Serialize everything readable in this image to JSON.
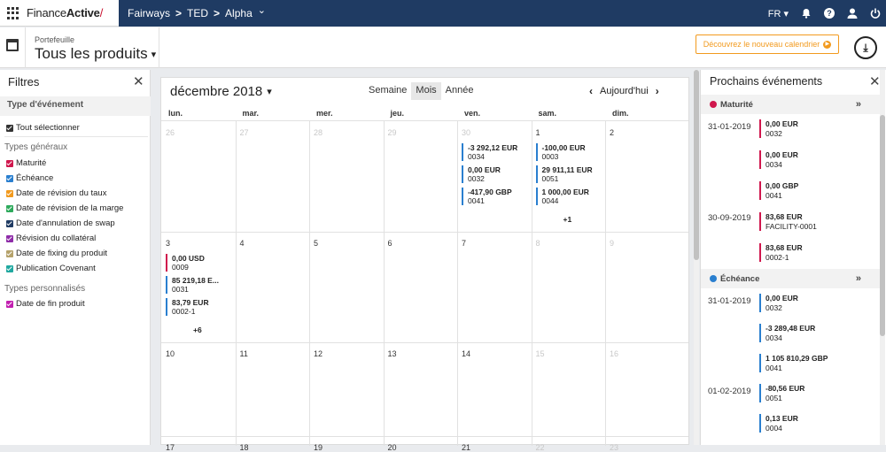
{
  "app": {
    "logo_main": "Finance",
    "logo_bold": "Active",
    "logo_slash": "/"
  },
  "breadcrumb": {
    "items": [
      "Fairways",
      "TED",
      "Alpha"
    ],
    "sep": ">",
    "caret": "⌄"
  },
  "topright": {
    "lang": "FR ▾"
  },
  "header": {
    "portfolio_label": "Portefeuille",
    "portfolio_title": "Tous les produits",
    "caret": "▾",
    "new_calendar": "Découvrez le nouveau calendrier",
    "play": "▶",
    "download": "⤓"
  },
  "filters": {
    "title": "Filtres",
    "close": "✕",
    "section": "Type d'événement",
    "select_all": "Tout sélectionner",
    "general_label": "Types généraux",
    "general": [
      {
        "label": "Maturité",
        "color": "#d0174d"
      },
      {
        "label": "Échéance",
        "color": "#2a7fcf"
      },
      {
        "label": "Date de révision du taux",
        "color": "#f29a1e"
      },
      {
        "label": "Date de révision de la marge",
        "color": "#2eaa5c"
      },
      {
        "label": "Date d'annulation de swap",
        "color": "#1f3b63"
      },
      {
        "label": "Révision du collatéral",
        "color": "#8e2ca8"
      },
      {
        "label": "Date de fixing du produit",
        "color": "#b5a26b"
      },
      {
        "label": "Publication Covenant",
        "color": "#20a8a0"
      }
    ],
    "custom_label": "Types personnalisés",
    "custom": [
      {
        "label": "Date de fin produit",
        "color": "#c21fb0"
      }
    ],
    "select_all_color": "#333333"
  },
  "calendar": {
    "month": "décembre 2018",
    "caret": "▾",
    "views": [
      "Semaine",
      "Mois",
      "Année"
    ],
    "active_view": "Mois",
    "prev": "‹",
    "today": "Aujourd'hui",
    "next": "›",
    "weekdays": [
      "lun.",
      "mar.",
      "mer.",
      "jeu.",
      "ven.",
      "sam.",
      "dim."
    ],
    "week1": [
      "26",
      "27",
      "28",
      "29",
      "30",
      "1",
      "2"
    ],
    "week2": [
      "3",
      "4",
      "5",
      "6",
      "7",
      "8",
      "9"
    ],
    "week3": [
      "10",
      "11",
      "12",
      "13",
      "14",
      "15",
      "16"
    ],
    "week4": [
      "17",
      "18",
      "19",
      "20",
      "21",
      "22",
      "23"
    ],
    "fri30": [
      {
        "amount": "-3 292,12 EUR",
        "ref": "0034"
      },
      {
        "amount": "0,00 EUR",
        "ref": "0032"
      },
      {
        "amount": "-417,90 GBP",
        "ref": "0041"
      }
    ],
    "sat1": [
      {
        "amount": "-100,00 EUR",
        "ref": "0003"
      },
      {
        "amount": "29 911,11 EUR",
        "ref": "0051"
      },
      {
        "amount": "1 000,00 EUR",
        "ref": "0044"
      }
    ],
    "sat1_more": "+1",
    "mon3": [
      {
        "amount": "0,00 USD",
        "ref": "0009"
      },
      {
        "amount": "85 219,18 E...",
        "ref": "0031"
      },
      {
        "amount": "83,79 EUR",
        "ref": "0002-1"
      }
    ],
    "mon3_more": "+6"
  },
  "upcoming": {
    "title": "Prochains événements",
    "close": "✕",
    "expand": "»",
    "maturite": {
      "label": "Maturité",
      "color": "#d0174d"
    },
    "echeance": {
      "label": "Échéance",
      "color": "#2a7fcf"
    },
    "mat_dates": [
      "31-01-2019",
      "30-09-2019"
    ],
    "mat_events": [
      {
        "amount": "0,00 EUR",
        "ref": "0032"
      },
      {
        "amount": "0,00 EUR",
        "ref": "0034"
      },
      {
        "amount": "0,00 GBP",
        "ref": "0041"
      },
      {
        "amount": "83,68 EUR",
        "ref": "FACILITY-0001"
      },
      {
        "amount": "83,68 EUR",
        "ref": "0002-1"
      }
    ],
    "ech_dates": [
      "31-01-2019",
      "01-02-2019"
    ],
    "ech_events": [
      {
        "amount": "0,00 EUR",
        "ref": "0032"
      },
      {
        "amount": "-3 289,48 EUR",
        "ref": "0034"
      },
      {
        "amount": "1 105 810,29 GBP",
        "ref": "0041"
      },
      {
        "amount": "-80,56 EUR",
        "ref": "0051"
      },
      {
        "amount": "0,13 EUR",
        "ref": "0004"
      }
    ]
  }
}
